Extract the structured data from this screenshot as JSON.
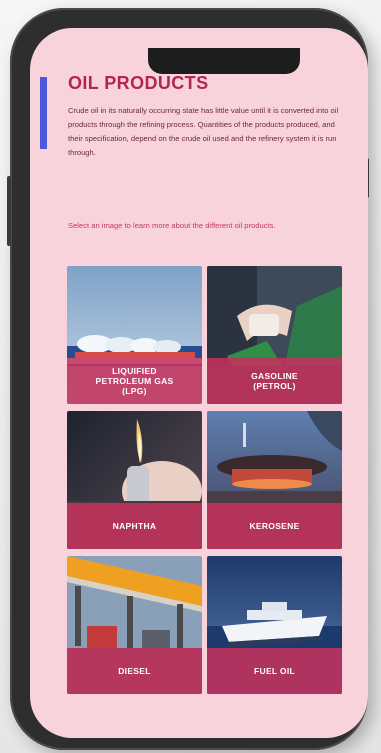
{
  "page": {
    "title": "OIL PRODUCTS",
    "intro": "Crude oil in its naturally occurring state has little value until it is converted into oil products through the refining process. Quantities of the products produced, and their specification, depend on the crude oil used and the refinery system it is run through.",
    "select_prompt": "Select an image to learn more about the different oil products."
  },
  "products": [
    {
      "label": "LIQUIFIED\nPETROLEUM GAS\n(LPG)"
    },
    {
      "label": "GASOLINE\n(PETROL)"
    },
    {
      "label": "NAPHTHA"
    },
    {
      "label": "KEROSENE"
    },
    {
      "label": "DIESEL"
    },
    {
      "label": "FUEL OIL"
    }
  ],
  "colors": {
    "screen_bg": "#f8d3dc",
    "title": "#b3264e",
    "accent_bar": "#4a58d9",
    "label_band": "#c3325c"
  }
}
